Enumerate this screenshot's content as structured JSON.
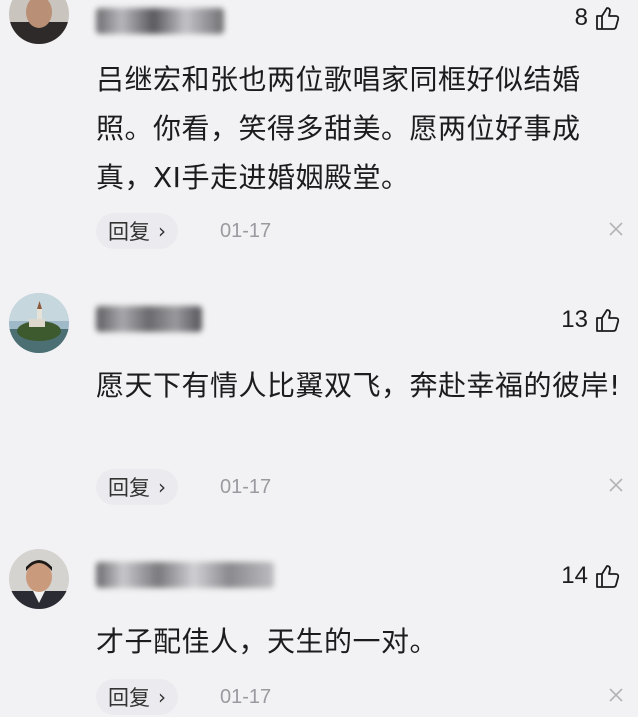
{
  "comments": [
    {
      "likes": "8",
      "text": "吕继宏和张也两位歌唱家同框好似结婚照。你看，笑得多甜美。愿两位好事成真，XI手走进婚姻殿堂。",
      "reply_label": "回复",
      "date": "01-17",
      "avatar_icon": "elderly-man-avatar"
    },
    {
      "likes": "13",
      "text": "愿天下有情人比翼双飞，奔赴幸福的彼岸!",
      "reply_label": "回复",
      "date": "01-17",
      "avatar_icon": "island-church-avatar"
    },
    {
      "likes": "14",
      "text": "才子配佳人，天生的一对。",
      "reply_label": "回复",
      "date": "01-17",
      "avatar_icon": "man-in-suit-avatar"
    }
  ]
}
